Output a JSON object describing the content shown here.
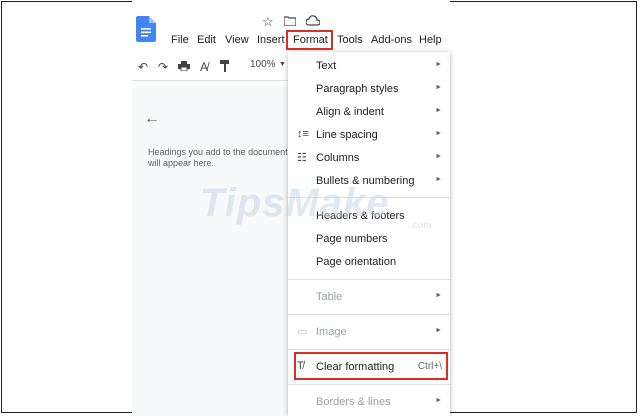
{
  "menubar": {
    "file": "File",
    "edit": "Edit",
    "view": "View",
    "insert": "Insert",
    "format": "Format",
    "tools": "Tools",
    "addons": "Add-ons",
    "help": "Help"
  },
  "toolbar": {
    "zoom": "100%"
  },
  "outline": {
    "placeholder": "Headings you add to the document will appear here."
  },
  "watermark": {
    "brand": "TipsMake",
    "suffix": ".com"
  },
  "format_menu": {
    "text": "Text",
    "paragraph_styles": "Paragraph styles",
    "align_indent": "Align & indent",
    "line_spacing": "Line spacing",
    "columns": "Columns",
    "bullets": "Bullets & numbering",
    "headers_footers": "Headers & footers",
    "page_numbers": "Page numbers",
    "page_orientation": "Page orientation",
    "table": "Table",
    "image": "Image",
    "clear_formatting": "Clear formatting",
    "clear_shortcut": "Ctrl+\\",
    "borders_lines": "Borders & lines"
  },
  "colors": {
    "highlight": "#d93025",
    "docs_blue": "#4285f4"
  }
}
